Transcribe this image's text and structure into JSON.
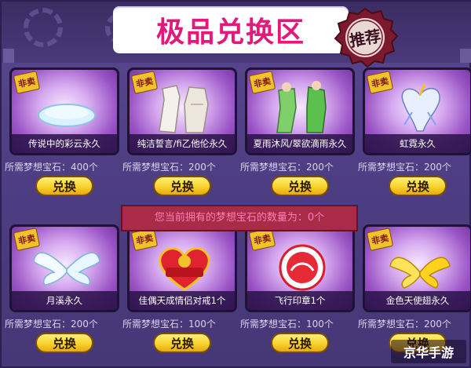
{
  "header": {
    "title": "极品兑换区",
    "stamp_text": "推荐"
  },
  "notice": {
    "text": "您当前拥有的梦想宝石的数量为：0个"
  },
  "items": [
    {
      "badge": "非卖",
      "name": "传说中的彩云永久",
      "price": "所需梦想宝石：400个",
      "button": "兑换",
      "icon": "cloud-icon"
    },
    {
      "badge": "非卖",
      "name": "纯洁誓言/fi乙他伦永久",
      "price": "所需梦想宝石：200个",
      "button": "兑换",
      "icon": "white-outfit-icon"
    },
    {
      "badge": "非卖",
      "name": "夏雨沐风/翠欲滴雨永久",
      "price": "所需梦想宝石：200个",
      "button": "兑换",
      "icon": "green-outfit-icon"
    },
    {
      "badge": "非卖",
      "name": "虹霓永久",
      "price": "所需梦想宝石：200个",
      "button": "兑换",
      "icon": "unicorn-icon"
    },
    {
      "badge": "非卖",
      "name": "月溪永久",
      "price": "所需梦想宝石：200个",
      "button": "兑换",
      "icon": "white-wings-icon"
    },
    {
      "badge": "非卖",
      "name": "佳偶天成情侣对戒1个",
      "price": "所需梦想宝石：100个",
      "button": "兑换",
      "icon": "love-heart-icon"
    },
    {
      "badge": "非卖",
      "name": "飞行印章1个",
      "price": "所需梦想宝石：100个",
      "button": "兑换",
      "icon": "fly-stamp-icon"
    },
    {
      "badge": "非卖",
      "name": "金色天使翅永久",
      "price": "所需梦想宝石：200个",
      "button": "兑换",
      "icon": "gold-wings-icon"
    }
  ],
  "watermark": {
    "text": "京华手游"
  },
  "colors": {
    "title": "#e2187a",
    "panel": "#4d3d82",
    "button": "#f8d22c",
    "notice_bg": "#a92b48",
    "notice_text": "#ff7fb6"
  }
}
